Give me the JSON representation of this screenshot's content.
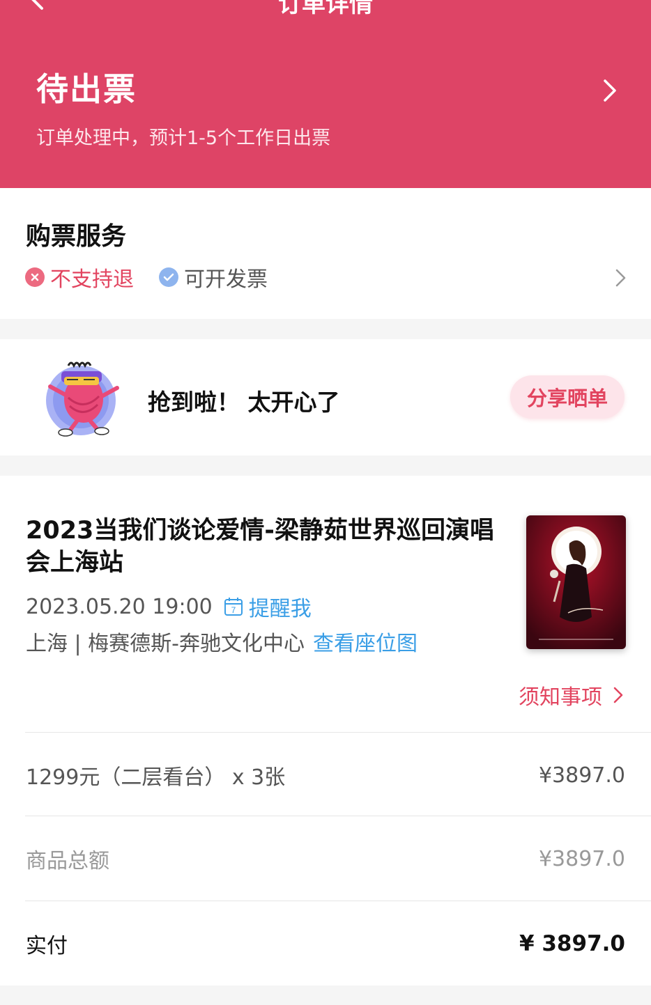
{
  "header": {
    "nav_title": "订单详情",
    "status_title": "待出票",
    "status_desc": "订单处理中，预计1-5个工作日出票",
    "icons": {
      "back": "back-arrow-icon",
      "forward": "chevron-right-icon"
    }
  },
  "service": {
    "title": "购票服务",
    "tags": [
      {
        "label": "不支持退",
        "icon": "x-circle-icon",
        "color": "#e2445f"
      },
      {
        "label": "可开发票",
        "icon": "check-circle-icon",
        "color": "#8eb4ee"
      }
    ]
  },
  "share": {
    "text": "抢到啦！ 太开心了",
    "button_label": "分享晒单"
  },
  "event": {
    "title": "2023当我们谈论爱情-梁静茹世界巡回演唱会上海站",
    "datetime": "2023.05.20 19:00",
    "calendar_day": "7",
    "remind_label": "提醒我",
    "venue": "上海 | 梅赛德斯-奔驰文化中心",
    "seat_map_label": "查看座位图",
    "notice_label": "须知事项"
  },
  "order": {
    "ticket_desc": "1299元（二层看台） x 3张",
    "ticket_amount": "¥3897.0",
    "subtotal_label": "商品总额",
    "subtotal_amount": "¥3897.0",
    "paid_label": "实付",
    "paid_amount": "¥ 3897.0"
  },
  "colors": {
    "brand": "#de4466",
    "accent_text": "#e2445f",
    "link": "#3a9ee6"
  }
}
